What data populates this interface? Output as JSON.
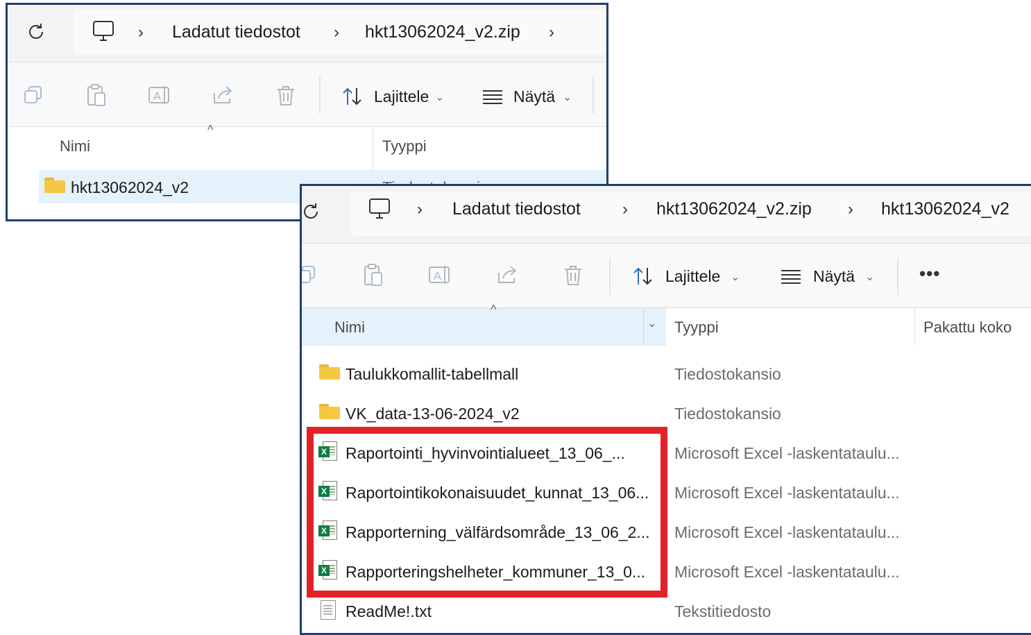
{
  "window1": {
    "breadcrumbs": [
      "Ladatut tiedostot",
      "hkt13062024_v2.zip"
    ],
    "toolbar": {
      "sort_label": "Lajittele",
      "view_label": "Näytä"
    },
    "columns": {
      "name": "Nimi",
      "type": "Tyyppi"
    },
    "rows": [
      {
        "name": "hkt13062024_v2",
        "type": "Tiedostokansio",
        "icon": "folder-icon"
      }
    ]
  },
  "window2": {
    "breadcrumbs": [
      "Ladatut tiedostot",
      "hkt13062024_v2.zip",
      "hkt13062024_v2"
    ],
    "toolbar": {
      "sort_label": "Lajittele",
      "view_label": "Näytä",
      "more_label": "•••"
    },
    "columns": {
      "name": "Nimi",
      "type": "Tyyppi",
      "packed_size": "Pakattu koko"
    },
    "rows": [
      {
        "name": "Taulukkomallit-tabellmall",
        "type": "Tiedostokansio",
        "icon": "folder-icon"
      },
      {
        "name": "VK_data-13-06-2024_v2",
        "type": "Tiedostokansio",
        "icon": "folder-icon"
      },
      {
        "name": "Raportointi_hyvinvointialueet_13_06_...",
        "type": "Microsoft Excel -laskentataulu...",
        "icon": "excel-icon"
      },
      {
        "name": "Raportointikokonaisuudet_kunnat_13_06...",
        "type": "Microsoft Excel -laskentataulu...",
        "icon": "excel-icon"
      },
      {
        "name": "Rapporterning_välfärdsområde_13_06_2...",
        "type": "Microsoft Excel -laskentataulu...",
        "icon": "excel-icon"
      },
      {
        "name": "Rapporteringshelheter_kommuner_13_0...",
        "type": "Microsoft Excel -laskentataulu...",
        "icon": "excel-icon"
      },
      {
        "name": "ReadMe!.txt",
        "type": "Tekstitiedosto",
        "icon": "text-file-icon"
      }
    ]
  },
  "colors": {
    "window_border": "#1f3f6e",
    "highlight_box": "#e32228",
    "excel_green": "#107c41",
    "folder_yellow": "#f5c842",
    "selection_blue": "#e5f1fb"
  }
}
